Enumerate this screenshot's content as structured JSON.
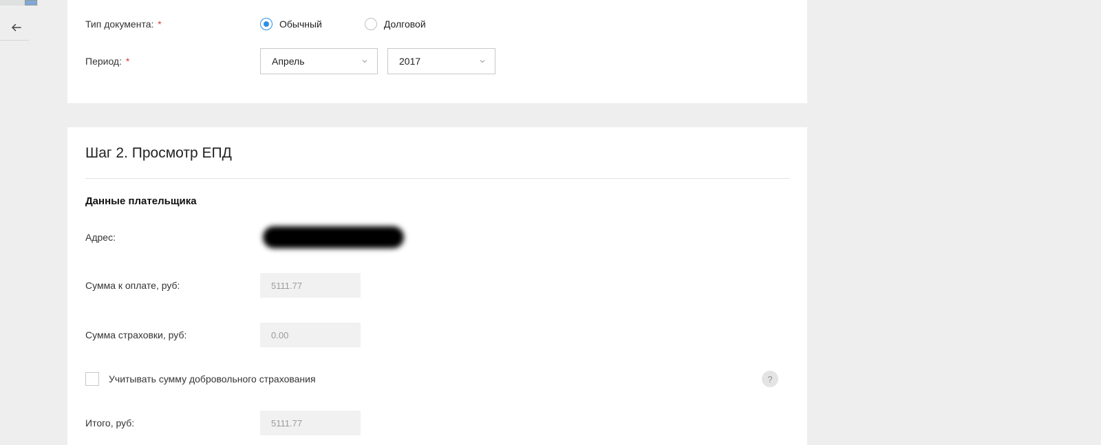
{
  "step1": {
    "doc_type": {
      "label": "Тип документа:",
      "options": {
        "normal": "Обычный",
        "debt": "Долговой"
      },
      "selected": "normal"
    },
    "period": {
      "label": "Период:",
      "month": "Апрель",
      "year": "2017"
    }
  },
  "step2": {
    "title": "Шаг 2. Просмотр ЕПД",
    "section_title": "Данные плательщика",
    "address": {
      "label": "Адрес:",
      "value": "[скрыто]"
    },
    "amount": {
      "label": "Сумма к оплате, руб:",
      "value": "5111.77"
    },
    "insurance": {
      "label": "Сумма страховки, руб:",
      "value": "0.00"
    },
    "checkbox": {
      "label": "Учитывать сумму добровольного страхования",
      "checked": false
    },
    "help_tooltip": "?",
    "total": {
      "label": "Итого, руб:",
      "value": "5111.77"
    }
  }
}
